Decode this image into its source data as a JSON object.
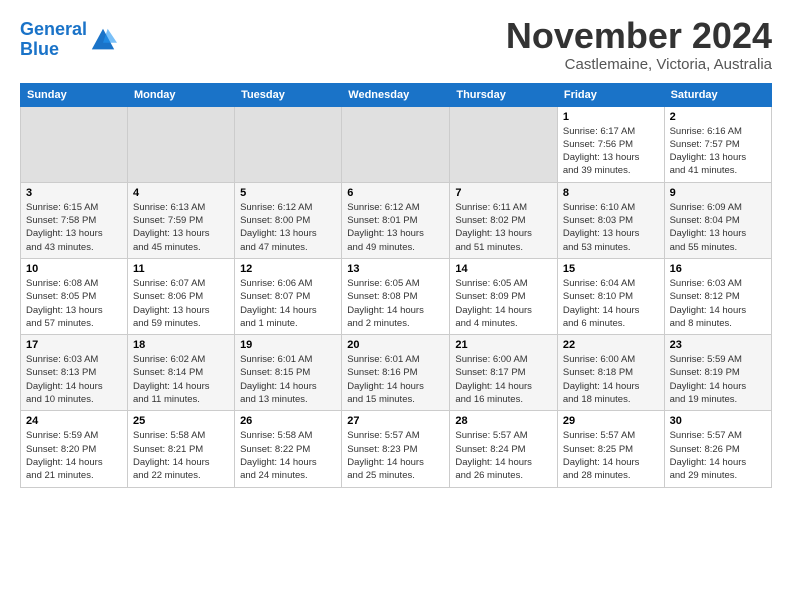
{
  "logo": {
    "line1": "General",
    "line2": "Blue"
  },
  "title": "November 2024",
  "subtitle": "Castlemaine, Victoria, Australia",
  "days_of_week": [
    "Sunday",
    "Monday",
    "Tuesday",
    "Wednesday",
    "Thursday",
    "Friday",
    "Saturday"
  ],
  "weeks": [
    [
      {
        "day": "",
        "info": ""
      },
      {
        "day": "",
        "info": ""
      },
      {
        "day": "",
        "info": ""
      },
      {
        "day": "",
        "info": ""
      },
      {
        "day": "",
        "info": ""
      },
      {
        "day": "1",
        "info": "Sunrise: 6:17 AM\nSunset: 7:56 PM\nDaylight: 13 hours\nand 39 minutes."
      },
      {
        "day": "2",
        "info": "Sunrise: 6:16 AM\nSunset: 7:57 PM\nDaylight: 13 hours\nand 41 minutes."
      }
    ],
    [
      {
        "day": "3",
        "info": "Sunrise: 6:15 AM\nSunset: 7:58 PM\nDaylight: 13 hours\nand 43 minutes."
      },
      {
        "day": "4",
        "info": "Sunrise: 6:13 AM\nSunset: 7:59 PM\nDaylight: 13 hours\nand 45 minutes."
      },
      {
        "day": "5",
        "info": "Sunrise: 6:12 AM\nSunset: 8:00 PM\nDaylight: 13 hours\nand 47 minutes."
      },
      {
        "day": "6",
        "info": "Sunrise: 6:12 AM\nSunset: 8:01 PM\nDaylight: 13 hours\nand 49 minutes."
      },
      {
        "day": "7",
        "info": "Sunrise: 6:11 AM\nSunset: 8:02 PM\nDaylight: 13 hours\nand 51 minutes."
      },
      {
        "day": "8",
        "info": "Sunrise: 6:10 AM\nSunset: 8:03 PM\nDaylight: 13 hours\nand 53 minutes."
      },
      {
        "day": "9",
        "info": "Sunrise: 6:09 AM\nSunset: 8:04 PM\nDaylight: 13 hours\nand 55 minutes."
      }
    ],
    [
      {
        "day": "10",
        "info": "Sunrise: 6:08 AM\nSunset: 8:05 PM\nDaylight: 13 hours\nand 57 minutes."
      },
      {
        "day": "11",
        "info": "Sunrise: 6:07 AM\nSunset: 8:06 PM\nDaylight: 13 hours\nand 59 minutes."
      },
      {
        "day": "12",
        "info": "Sunrise: 6:06 AM\nSunset: 8:07 PM\nDaylight: 14 hours\nand 1 minute."
      },
      {
        "day": "13",
        "info": "Sunrise: 6:05 AM\nSunset: 8:08 PM\nDaylight: 14 hours\nand 2 minutes."
      },
      {
        "day": "14",
        "info": "Sunrise: 6:05 AM\nSunset: 8:09 PM\nDaylight: 14 hours\nand 4 minutes."
      },
      {
        "day": "15",
        "info": "Sunrise: 6:04 AM\nSunset: 8:10 PM\nDaylight: 14 hours\nand 6 minutes."
      },
      {
        "day": "16",
        "info": "Sunrise: 6:03 AM\nSunset: 8:12 PM\nDaylight: 14 hours\nand 8 minutes."
      }
    ],
    [
      {
        "day": "17",
        "info": "Sunrise: 6:03 AM\nSunset: 8:13 PM\nDaylight: 14 hours\nand 10 minutes."
      },
      {
        "day": "18",
        "info": "Sunrise: 6:02 AM\nSunset: 8:14 PM\nDaylight: 14 hours\nand 11 minutes."
      },
      {
        "day": "19",
        "info": "Sunrise: 6:01 AM\nSunset: 8:15 PM\nDaylight: 14 hours\nand 13 minutes."
      },
      {
        "day": "20",
        "info": "Sunrise: 6:01 AM\nSunset: 8:16 PM\nDaylight: 14 hours\nand 15 minutes."
      },
      {
        "day": "21",
        "info": "Sunrise: 6:00 AM\nSunset: 8:17 PM\nDaylight: 14 hours\nand 16 minutes."
      },
      {
        "day": "22",
        "info": "Sunrise: 6:00 AM\nSunset: 8:18 PM\nDaylight: 14 hours\nand 18 minutes."
      },
      {
        "day": "23",
        "info": "Sunrise: 5:59 AM\nSunset: 8:19 PM\nDaylight: 14 hours\nand 19 minutes."
      }
    ],
    [
      {
        "day": "24",
        "info": "Sunrise: 5:59 AM\nSunset: 8:20 PM\nDaylight: 14 hours\nand 21 minutes."
      },
      {
        "day": "25",
        "info": "Sunrise: 5:58 AM\nSunset: 8:21 PM\nDaylight: 14 hours\nand 22 minutes."
      },
      {
        "day": "26",
        "info": "Sunrise: 5:58 AM\nSunset: 8:22 PM\nDaylight: 14 hours\nand 24 minutes."
      },
      {
        "day": "27",
        "info": "Sunrise: 5:57 AM\nSunset: 8:23 PM\nDaylight: 14 hours\nand 25 minutes."
      },
      {
        "day": "28",
        "info": "Sunrise: 5:57 AM\nSunset: 8:24 PM\nDaylight: 14 hours\nand 26 minutes."
      },
      {
        "day": "29",
        "info": "Sunrise: 5:57 AM\nSunset: 8:25 PM\nDaylight: 14 hours\nand 28 minutes."
      },
      {
        "day": "30",
        "info": "Sunrise: 5:57 AM\nSunset: 8:26 PM\nDaylight: 14 hours\nand 29 minutes."
      }
    ]
  ]
}
